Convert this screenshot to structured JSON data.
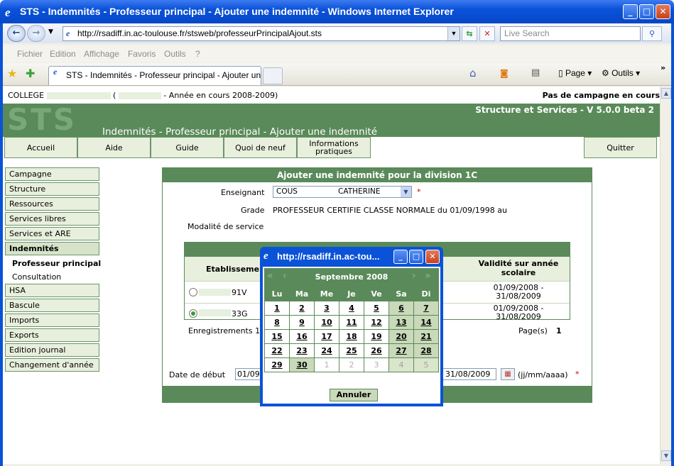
{
  "window": {
    "title": "STS - Indemnités - Professeur principal - Ajouter une indemnité - Windows Internet Explorer"
  },
  "browser": {
    "url": "http://rsadiff.in.ac-toulouse.fr/stsweb/professeurPrincipalAjout.sts",
    "search_placeholder": "Live Search",
    "menu": [
      "Fichier",
      "Edition",
      "Affichage",
      "Favoris",
      "Outils",
      "?"
    ],
    "tab_title": "STS - Indemnités - Professeur principal - Ajouter une i...",
    "page_label": "Page",
    "tools_label": "Outils"
  },
  "header": {
    "college_prefix": "COLLEGE",
    "year_text": "- Année en cours 2008-2009)",
    "campaign": "Pas de campagne en cours",
    "logo": "STS",
    "version": "Structure et Services - V 5.0.0 beta 2",
    "page_title": "Indemnités - Professeur principal - Ajouter une indemnité"
  },
  "nav": {
    "accueil": "Accueil",
    "aide": "Aide",
    "guide": "Guide",
    "quoi": "Quoi de neuf",
    "info1": "Informations",
    "info2": "pratiques",
    "quitter": "Quitter"
  },
  "sidebar": {
    "items": [
      "Campagne",
      "Structure",
      "Ressources",
      "Services libres",
      "Services et ARE",
      "Indemnités",
      "HSA",
      "Bascule",
      "Imports",
      "Exports",
      "Edition journal",
      "Changement d'année"
    ],
    "sub": [
      "Professeur principal",
      "Consultation"
    ]
  },
  "form": {
    "heading": "Ajouter une indemnité pour la division 1C",
    "enseignant_label": "Enseignant",
    "enseignant_nom": "COUS",
    "enseignant_prenom": "CATHERINE",
    "grade_label": "Grade",
    "grade_value": "PROFESSEUR CERTIFIE CLASSE NORMALE  du  01/09/1998  au",
    "modalite_label": "Modalité de service",
    "col_etab": "Etablissement",
    "col_valid1": "Validité sur année",
    "col_valid2": "scolaire",
    "rows": [
      {
        "code": "91V",
        "v1": "01/09/2008 -",
        "v2": "31/08/2009"
      },
      {
        "code": "33G",
        "v1": "01/09/2008 -",
        "v2": "31/08/2009"
      }
    ],
    "records": "Enregistrements 1",
    "pages_label": "Page(s)",
    "pages_value": "1",
    "date_debut_label": "Date de début",
    "date_debut_value": "01/09",
    "date_fin_value": "31/08/2009",
    "date_hint": "(jj/mm/aaaa)",
    "required": "*"
  },
  "popup": {
    "title": "http://rsadiff.in.ac-tou...",
    "month": "Septembre 2008",
    "days": [
      "Lu",
      "Ma",
      "Me",
      "Je",
      "Ve",
      "Sa",
      "Di"
    ],
    "weeks": [
      [
        "1",
        "2",
        "3",
        "4",
        "5",
        "6",
        "7"
      ],
      [
        "8",
        "9",
        "10",
        "11",
        "12",
        "13",
        "14"
      ],
      [
        "15",
        "16",
        "17",
        "18",
        "19",
        "20",
        "21"
      ],
      [
        "22",
        "23",
        "24",
        "25",
        "26",
        "27",
        "28"
      ],
      [
        "29",
        "30",
        "1",
        "2",
        "3",
        "4",
        "5"
      ]
    ],
    "cancel": "Annuler"
  }
}
